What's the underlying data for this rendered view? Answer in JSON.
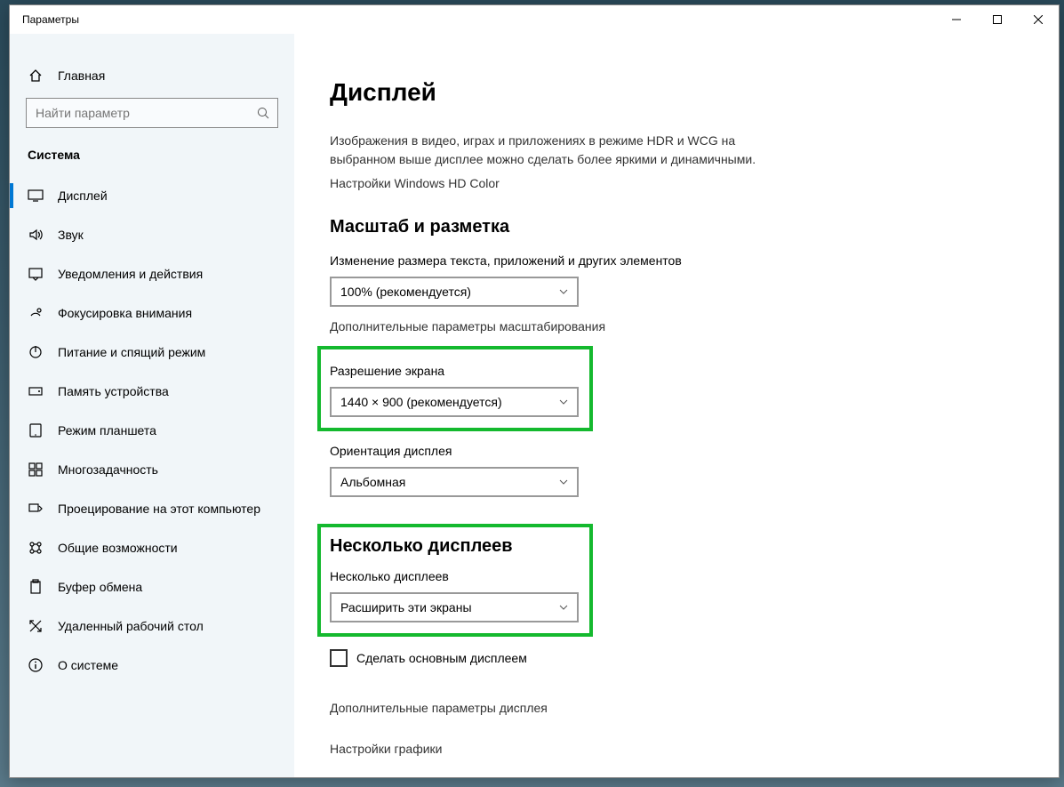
{
  "window": {
    "title": "Параметры"
  },
  "titlebar": {
    "min": "—",
    "max": "▢",
    "close": "✕"
  },
  "sidebar": {
    "home": "Главная",
    "search_placeholder": "Найти параметр",
    "category": "Система",
    "items": [
      {
        "label": "Дисплей",
        "icon": "display-icon",
        "active": true
      },
      {
        "label": "Звук",
        "icon": "sound-icon"
      },
      {
        "label": "Уведомления и действия",
        "icon": "notifications-icon"
      },
      {
        "label": "Фокусировка внимания",
        "icon": "focus-icon"
      },
      {
        "label": "Питание и спящий режим",
        "icon": "power-icon"
      },
      {
        "label": "Память устройства",
        "icon": "storage-icon"
      },
      {
        "label": "Режим планшета",
        "icon": "tablet-icon"
      },
      {
        "label": "Многозадачность",
        "icon": "multitask-icon"
      },
      {
        "label": "Проецирование на этот компьютер",
        "icon": "project-icon"
      },
      {
        "label": "Общие возможности",
        "icon": "shared-icon"
      },
      {
        "label": "Буфер обмена",
        "icon": "clipboard-icon"
      },
      {
        "label": "Удаленный рабочий стол",
        "icon": "remote-icon"
      },
      {
        "label": "О системе",
        "icon": "about-icon"
      }
    ]
  },
  "main": {
    "title": "Дисплей",
    "hdr_desc": "Изображения в видео, играх и приложениях в режиме HDR и WCG на выбранном выше дисплее можно сделать более яркими и динамичными.",
    "hdr_link": "Настройки Windows HD Color",
    "scale_heading": "Масштаб и разметка",
    "scale_label": "Изменение размера текста, приложений и других элементов",
    "scale_value": "100% (рекомендуется)",
    "scale_advanced": "Дополнительные параметры масштабирования",
    "res_label": "Разрешение экрана",
    "res_value": "1440 × 900 (рекомендуется)",
    "orient_label": "Ориентация дисплея",
    "orient_value": "Альбомная",
    "multi_heading": "Несколько дисплеев",
    "multi_label": "Несколько дисплеев",
    "multi_value": "Расширить эти экраны",
    "make_main": "Сделать основным дисплеем",
    "advanced_display": "Дополнительные параметры дисплея",
    "graphics": "Настройки графики"
  }
}
